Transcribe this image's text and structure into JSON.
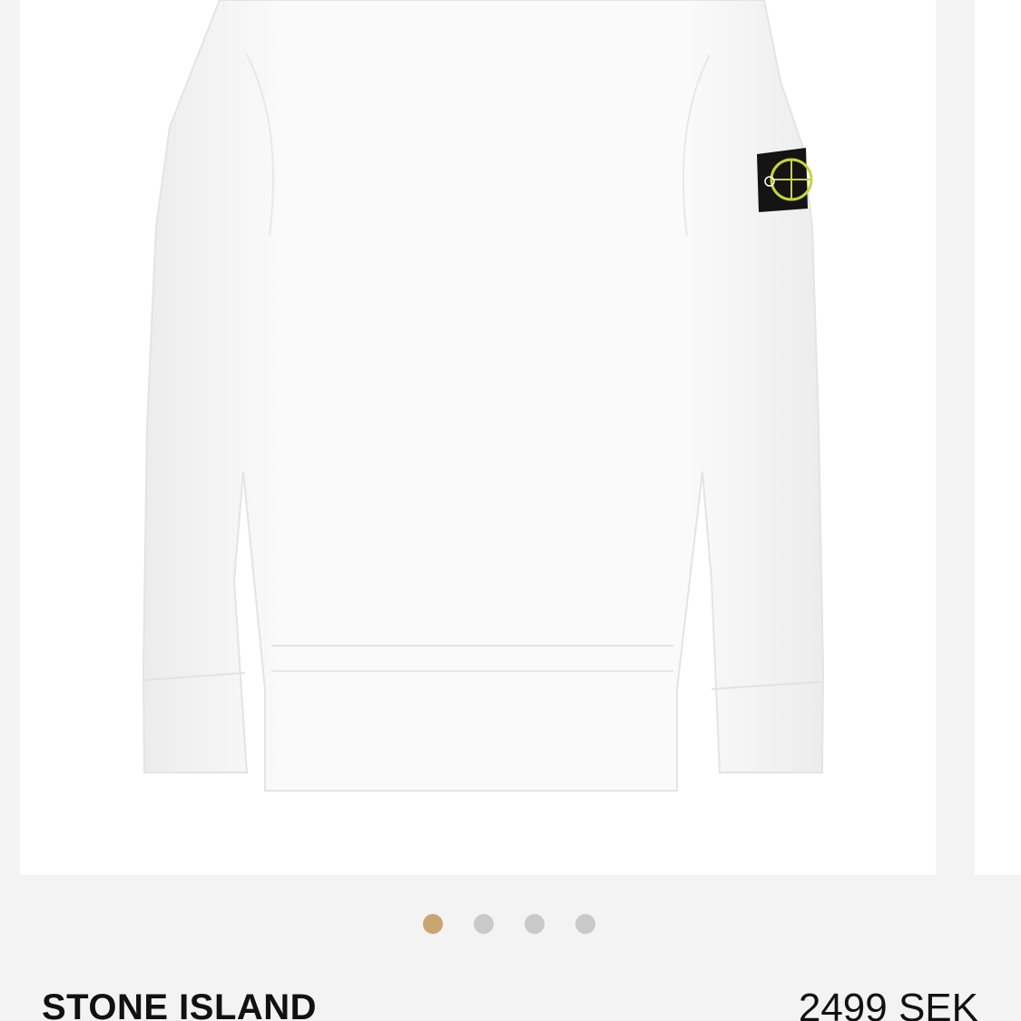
{
  "product": {
    "brand": "STONE ISLAND",
    "price": "2499 SEK",
    "image": {
      "subject-icon": "white-crewneck-sweatshirt-with-compass-badge",
      "garment_color": "#ffffff",
      "badge_color": "#111111",
      "compass_color": "#c8d43a"
    }
  },
  "gallery": {
    "slide_count": 4,
    "active_index": 0,
    "colors": {
      "active_dot": "#c8a673",
      "inactive_dot": "#c9c9c9"
    }
  }
}
